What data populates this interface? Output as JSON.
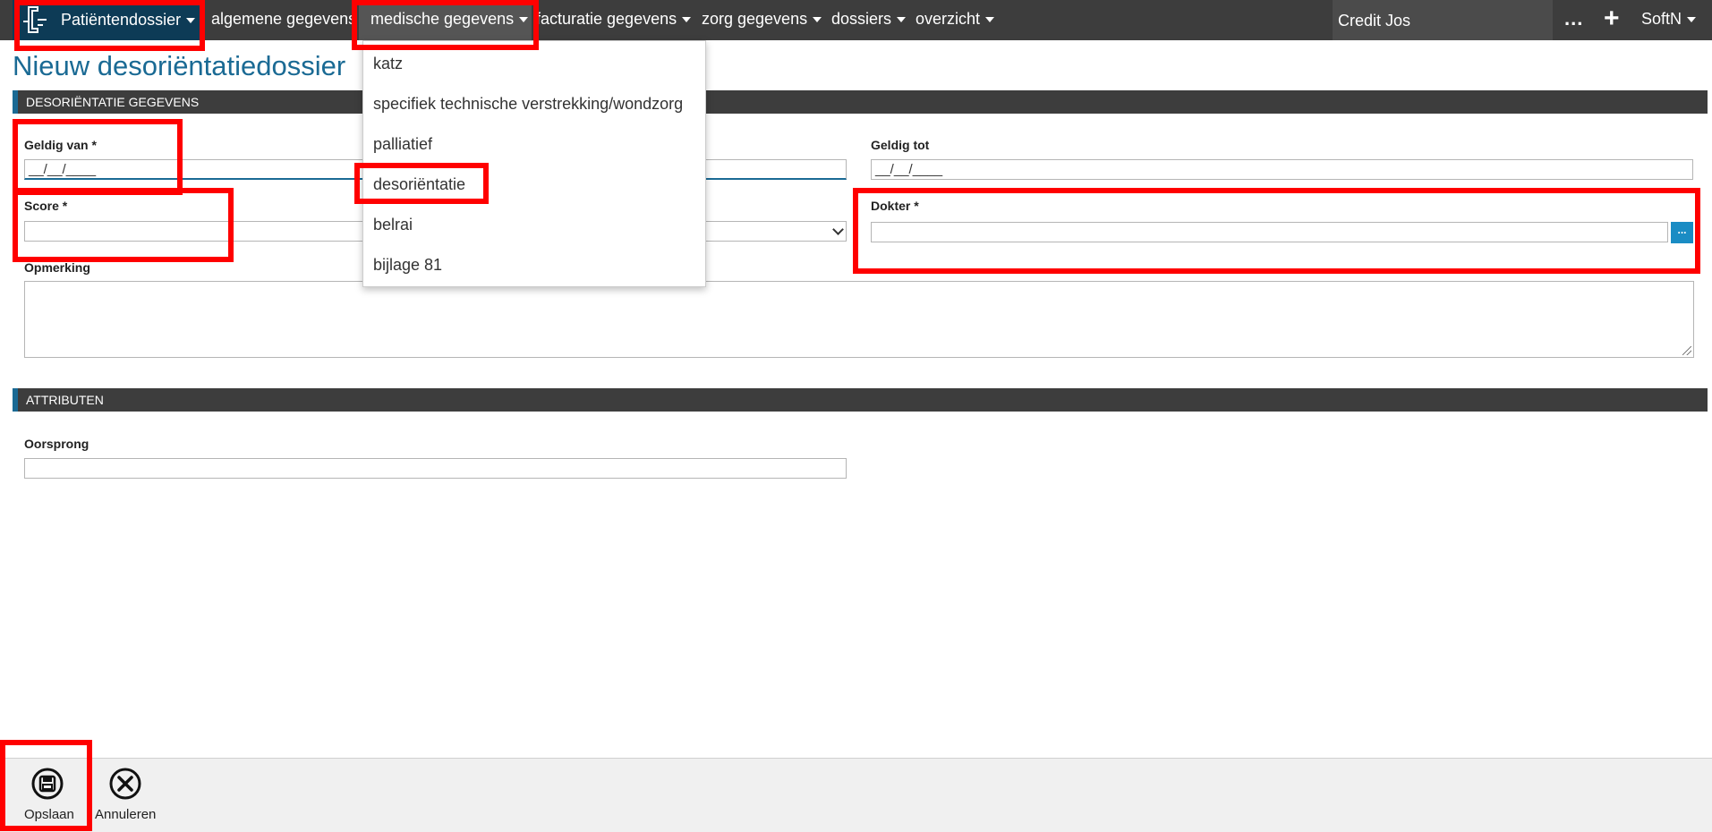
{
  "nav": {
    "brand": "Patiëntendossier",
    "items": [
      "algemene gegevens",
      "medische gegevens",
      "facturatie gegevens",
      "zorg gegevens",
      "dossiers",
      "overzicht"
    ],
    "user": "Credit Jos",
    "more": "...",
    "add": "+",
    "account": "SoftN"
  },
  "page": {
    "title": "Nieuw desoriëntatiedossier"
  },
  "sections": {
    "desorientatie": "DESORIËNTATIE GEGEVENS",
    "attributen": "ATTRIBUTEN"
  },
  "form": {
    "geldig_van_label": "Geldig van *",
    "geldig_van_value": "__/__/____",
    "geldig_tot_label": "Geldig tot",
    "geldig_tot_value": "__/__/____",
    "score_label": "Score *",
    "score_value": "",
    "dokter_label": "Dokter *",
    "dokter_button": "...",
    "opmerking_label": "Opmerking",
    "oorsprong_label": "Oorsprong",
    "oorsprong_value": ""
  },
  "dropdown": {
    "items": [
      "katz",
      "specifiek technische verstrekking/wondzorg",
      "palliatief",
      "desoriëntatie",
      "belrai",
      "bijlage 81"
    ]
  },
  "toolbar": {
    "save": "Opslaan",
    "cancel": "Annuleren"
  },
  "colors": {
    "accent": "#1a6a94",
    "navbar": "#3d3d3d",
    "brand_bg": "#0d3b56",
    "highlight": "#ff0000"
  }
}
